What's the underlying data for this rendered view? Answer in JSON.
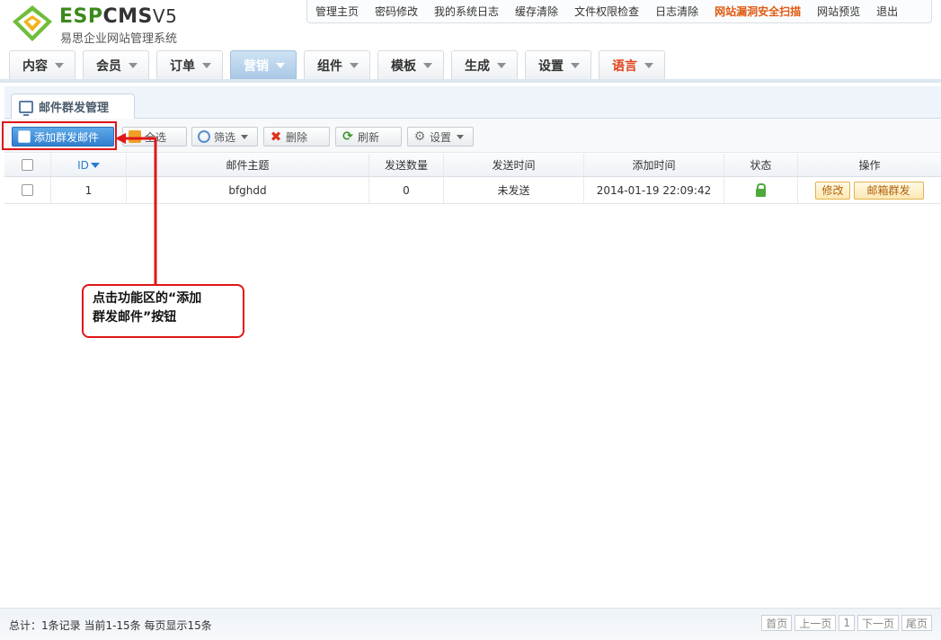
{
  "logo": {
    "brand_green": "ESP",
    "brand_dark": "CMS",
    "version": "V5",
    "subtitle": "易思企业网站管理系统"
  },
  "topnav": [
    "管理主页",
    "密码修改",
    "我的系统日志",
    "缓存清除",
    "文件权限检查",
    "日志清除",
    "网站漏洞安全扫描",
    "网站预览",
    "退出"
  ],
  "mainnav": [
    "内容",
    "会员",
    "订单",
    "营销",
    "组件",
    "模板",
    "生成",
    "设置",
    "语言"
  ],
  "panel": {
    "tab_label": "邮件群发管理"
  },
  "toolbar": {
    "add": "添加群发邮件",
    "select_all": "全选",
    "filter": "筛选",
    "delete": "删除",
    "refresh": "刷新",
    "settings": "设置"
  },
  "table": {
    "headers": {
      "id": "ID",
      "subject": "邮件主题",
      "count": "发送数量",
      "send_time": "发送时间",
      "add_time": "添加时间",
      "status": "状态",
      "ops": "操作"
    },
    "rows": [
      {
        "id": "1",
        "subject": "bfghdd",
        "count": "0",
        "send_time": "未发送",
        "add_time": "2014-01-19 22:09:42",
        "edit": "修改",
        "send": "邮箱群发"
      }
    ]
  },
  "callout": {
    "line1": "点击功能区的“添加",
    "line2": "群发邮件”按钮"
  },
  "footer": {
    "summary": "总计：1条记录 当前1-15条 每页显示15条",
    "first": "首页",
    "prev": "上一页",
    "page": "1",
    "next": "下一页",
    "last": "尾页"
  },
  "colors": {
    "accent_blue": "#2f7fcf",
    "highlight_red": "#e01616",
    "brand_green": "#3a8a1c",
    "warn_orange": "#e05a12"
  }
}
